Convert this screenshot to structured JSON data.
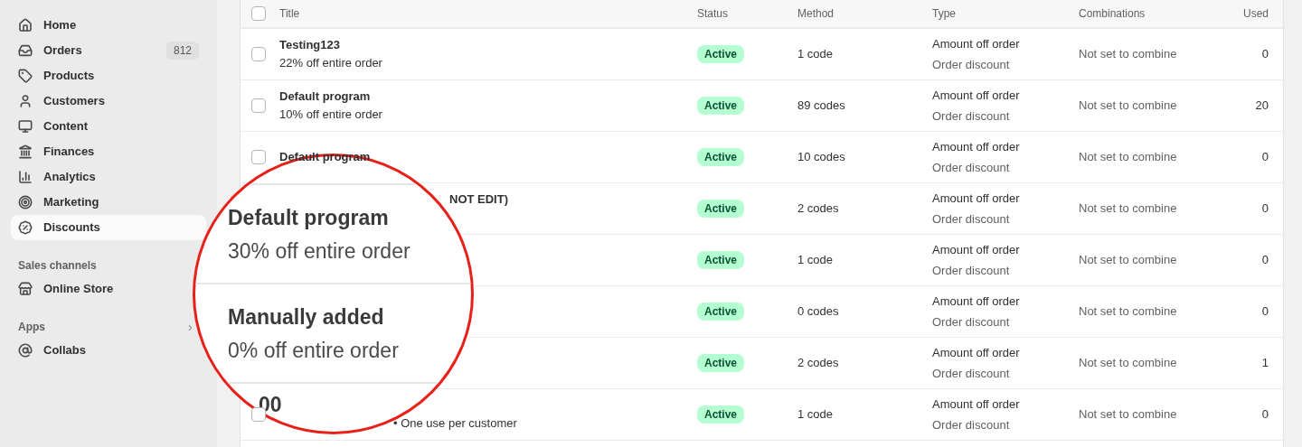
{
  "sidebar": {
    "items": [
      {
        "label": "Home",
        "selected": false
      },
      {
        "label": "Orders",
        "selected": false,
        "badge": "812"
      },
      {
        "label": "Products",
        "selected": false
      },
      {
        "label": "Customers",
        "selected": false
      },
      {
        "label": "Content",
        "selected": false
      },
      {
        "label": "Finances",
        "selected": false
      },
      {
        "label": "Analytics",
        "selected": false
      },
      {
        "label": "Marketing",
        "selected": false
      },
      {
        "label": "Discounts",
        "selected": true
      }
    ],
    "sections": [
      {
        "title": "Sales channels",
        "items": [
          {
            "label": "Online Store"
          }
        ]
      },
      {
        "title": "Apps",
        "chevron": "›",
        "items": [
          {
            "label": "Collabs"
          }
        ]
      }
    ]
  },
  "table": {
    "select_all_checked": false,
    "columns": [
      "Title",
      "Status",
      "Method",
      "Type",
      "Combinations",
      "Used"
    ],
    "rows": [
      {
        "checked": false,
        "title": "Testing123",
        "subtitle": "22% off entire order",
        "status": "Active",
        "method": "1 code",
        "type": "Amount off order",
        "type_detail": "Order discount",
        "combinations": "Not set to combine",
        "used": "0"
      },
      {
        "checked": false,
        "title": "Default program",
        "subtitle": "10% off entire order",
        "status": "Active",
        "method": "89 codes",
        "type": "Amount off order",
        "type_detail": "Order discount",
        "combinations": "Not set to combine",
        "used": "20"
      },
      {
        "checked": false,
        "title": "Default program",
        "status": "Active",
        "method": "10 codes",
        "type": "Amount off order",
        "type_detail": "Order discount",
        "combinations": "Not set to combine",
        "used": "0"
      },
      {
        "title_tail": "NOT EDIT)",
        "status": "Active",
        "method": "2 codes",
        "type": "Amount off order",
        "type_detail": "Order discount",
        "combinations": "Not set to combine",
        "used": "0"
      },
      {
        "status": "Active",
        "method": "1 code",
        "type": "Amount off order",
        "type_detail": "Order discount",
        "combinations": "Not set to combine",
        "used": "0"
      },
      {
        "status": "Active",
        "method": "0 codes",
        "type": "Amount off order",
        "type_detail": "Order discount",
        "combinations": "Not set to combine",
        "used": "0"
      },
      {
        "status": "Active",
        "method": "2 codes",
        "type": "Amount off order",
        "type_detail": "Order discount",
        "combinations": "Not set to combine",
        "used": "1"
      },
      {
        "checked": false,
        "subtitle_tail": "• One use per customer",
        "status": "Active",
        "method": "1 code",
        "type": "Amount off order",
        "type_detail": "Order discount",
        "combinations": "Not set to combine",
        "used": "0"
      }
    ]
  },
  "magnifier": {
    "entries": [
      {
        "title": "Default program",
        "subtitle": "30% off entire order"
      },
      {
        "title": "Manually added",
        "subtitle": "0% off entire order"
      },
      {
        "title": "00"
      }
    ]
  }
}
